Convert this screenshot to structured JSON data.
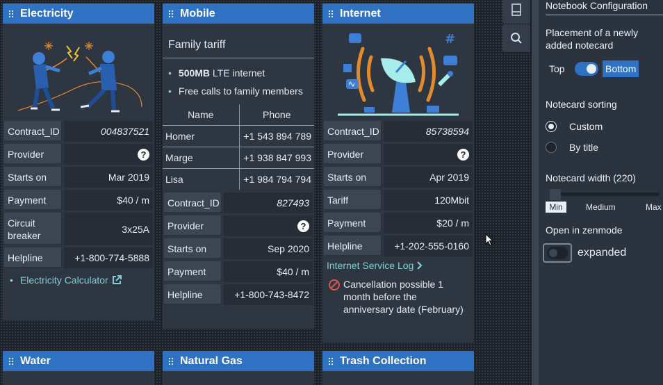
{
  "cards": {
    "electricity": {
      "title": "Electricity",
      "rows": [
        {
          "label": "Contract_ID",
          "value": "004837521"
        },
        {
          "label": "Provider",
          "value": "?"
        },
        {
          "label": "Starts on",
          "value": "Mar 2019"
        },
        {
          "label": "Payment",
          "value": "$40 / m"
        },
        {
          "label": "Circuit breaker",
          "value": "3x25A"
        },
        {
          "label": "Helpline",
          "value": "+1-800-774-5888"
        }
      ],
      "link": "Electricity Calculator"
    },
    "mobile": {
      "title": "Mobile",
      "subtitle": "Family tariff",
      "bullets": [
        {
          "bold": "500MB",
          "text": " LTE internet"
        },
        {
          "bold": "",
          "text": "Free calls to family members"
        }
      ],
      "table": {
        "headers": [
          "Name",
          "Phone"
        ],
        "rows": [
          [
            "Homer",
            "+1 543 894 789"
          ],
          [
            "Marge",
            "+1 938 847 993"
          ],
          [
            "Lisa",
            "+1 984 794 794"
          ]
        ]
      },
      "rows": [
        {
          "label": "Contract_ID",
          "value": "827493"
        },
        {
          "label": "Provider",
          "value": "?"
        },
        {
          "label": "Starts on",
          "value": "Sep 2020"
        },
        {
          "label": "Payment",
          "value": "$40 / m"
        },
        {
          "label": "Helpline",
          "value": "+1-800-743-8472"
        }
      ]
    },
    "internet": {
      "title": "Internet",
      "rows": [
        {
          "label": "Contract_ID",
          "value": "85738594"
        },
        {
          "label": "Provider",
          "value": "?"
        },
        {
          "label": "Starts on",
          "value": "Apr 2019"
        },
        {
          "label": "Tariff",
          "value": "120Mbit"
        },
        {
          "label": "Payment",
          "value": "$20 / m"
        },
        {
          "label": "Helpline",
          "value": "+1-202-555-0160"
        }
      ],
      "link": "Internet Service Log",
      "notice": "Cancellation possible 1 month before the anniversary date (February)"
    },
    "water": {
      "title": "Water"
    },
    "gas": {
      "title": "Natural Gas"
    },
    "trash": {
      "title": "Trash Collection"
    }
  },
  "panel": {
    "title": "Notebook Configuration",
    "placement_label": "Placement of a newly added notecard",
    "placement_top": "Top",
    "placement_bottom": "Bottom",
    "sorting_label": "Notecard sorting",
    "sorting_custom": "Custom",
    "sorting_title": "By title",
    "sorting_selected": "Custom",
    "width_label": "Notecard width (220)",
    "width_min": "Min",
    "width_medium": "Medium",
    "width_max": "Max",
    "zen_label": "Open in zenmode",
    "zen_toggle_label": "expanded",
    "placement_value": "Bottom",
    "width_value": 0,
    "zen_value": false
  },
  "colors": {
    "header": "#2f72c4",
    "accent_link": "#7fd0d6",
    "card_bg": "#2e3641"
  },
  "icons": [
    "drag-grip-icon",
    "document-icon",
    "search-icon",
    "help-icon",
    "external-link-icon",
    "chevron-right-icon",
    "forbidden-icon",
    "mouse-cursor-icon"
  ]
}
